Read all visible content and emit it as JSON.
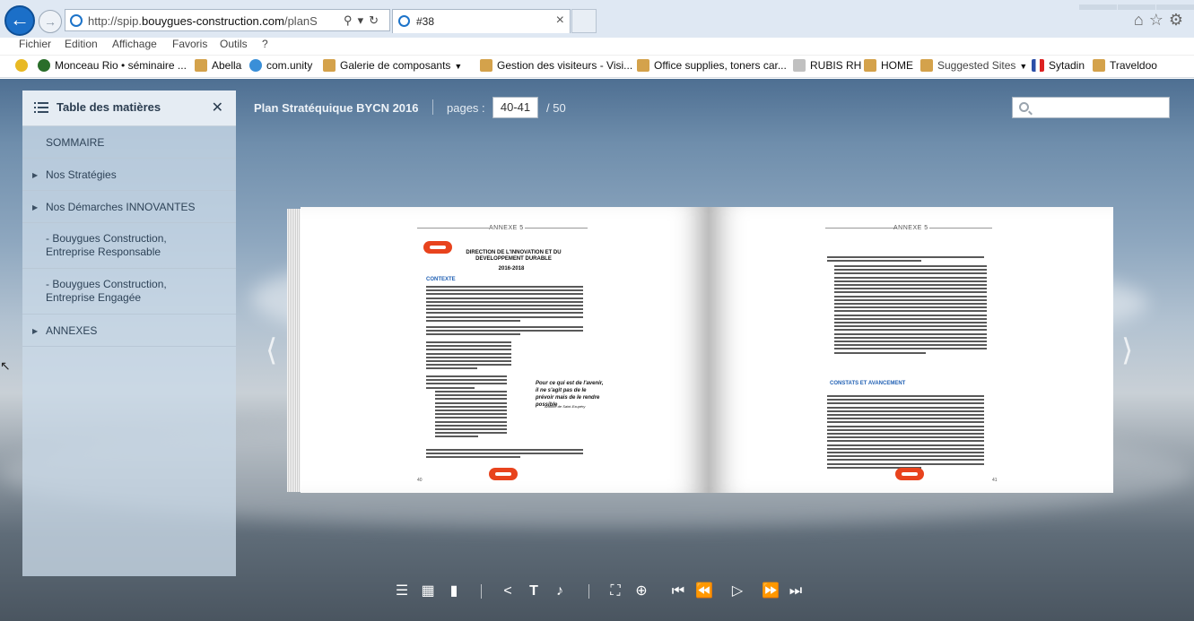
{
  "browser": {
    "url_prefix": "http://spip.",
    "url_domain": "bouygues-construction.com",
    "url_path": "/planStrategi",
    "tab_title": "#38"
  },
  "menu": [
    "Fichier",
    "Edition",
    "Affichage",
    "Favoris",
    "Outils",
    "?"
  ],
  "favorites": [
    {
      "label": "Monceau Rio • séminaire ...",
      "icon": "globe-icon",
      "color": "#2a6e2a"
    },
    {
      "label": "Abella",
      "icon": "page-icon",
      "color": "#d4a24b"
    },
    {
      "label": "com.unity",
      "icon": "com-unity-icon",
      "color": "#3a8fd8"
    },
    {
      "label": "Galerie de composants",
      "icon": "ie-page-icon",
      "color": "#d4a24b",
      "dropdown": true
    },
    {
      "label": "Gestion des visiteurs - Visi...",
      "icon": "ie-page-icon",
      "color": "#d4a24b"
    },
    {
      "label": "Office supplies, toners car...",
      "icon": "ie-page-icon",
      "color": "#d4a24b"
    },
    {
      "label": "RUBIS RH",
      "icon": "page-icon",
      "color": "#c0c0c0"
    },
    {
      "label": "HOME",
      "icon": "ie-page-icon",
      "color": "#d4a24b"
    },
    {
      "label": "Suggested Sites",
      "icon": "ie-page-icon",
      "color": "#d4a24b",
      "dropdown": true
    },
    {
      "label": "Sytadin",
      "icon": "flag-fr-icon",
      "color": "#2b4fa8"
    },
    {
      "label": "Traveldoo",
      "icon": "ie-page-icon",
      "color": "#d4a24b"
    }
  ],
  "toc": {
    "title": "Table des matières",
    "items": [
      {
        "label": "SOMMAIRE",
        "expandable": false
      },
      {
        "label": "Nos Stratégies",
        "expandable": true
      },
      {
        "label": "Nos Démarches INNOVANTES",
        "expandable": true
      },
      {
        "label": "- Bouygues Construction,",
        "label2": "Entreprise Responsable",
        "expandable": false
      },
      {
        "label": "- Bouygues Construction,",
        "label2": "Entreprise Engagée",
        "expandable": false
      },
      {
        "label": "ANNEXES",
        "expandable": true
      }
    ]
  },
  "viewer": {
    "book_title": "Plan Stratéquique BYCN 2016",
    "pages_label": "pages :",
    "pages_value": "40-41",
    "pages_total": "/ 50"
  },
  "book": {
    "left": {
      "annex": "ANNEXE 5",
      "title1": "DIRECTION DE L'INNOVATION ET DU",
      "title2": "DEVELOPPEMENT DURABLE",
      "years": "2016-2018",
      "section": "CONTEXTE",
      "quote": "Pour ce qui est de l'avenir, il ne s'agit pas de le prévoir mais de le rendre possible",
      "quote_author": "Antoine de Saint-Exupéry",
      "page_number": "40"
    },
    "right": {
      "annex": "ANNEXE 5",
      "section": "CONSTATS ET AVANCEMENT",
      "page_number": "41"
    }
  },
  "toolbar": [
    "toc-list-icon",
    "thumbnails-icon",
    "bookmark-icon",
    "share-icon",
    "text-icon",
    "sound-icon",
    "fullscreen-icon",
    "zoom-in-icon",
    "first-page-icon",
    "previous-page-icon",
    "slideshow-icon",
    "next-page-icon",
    "last-page-icon"
  ]
}
